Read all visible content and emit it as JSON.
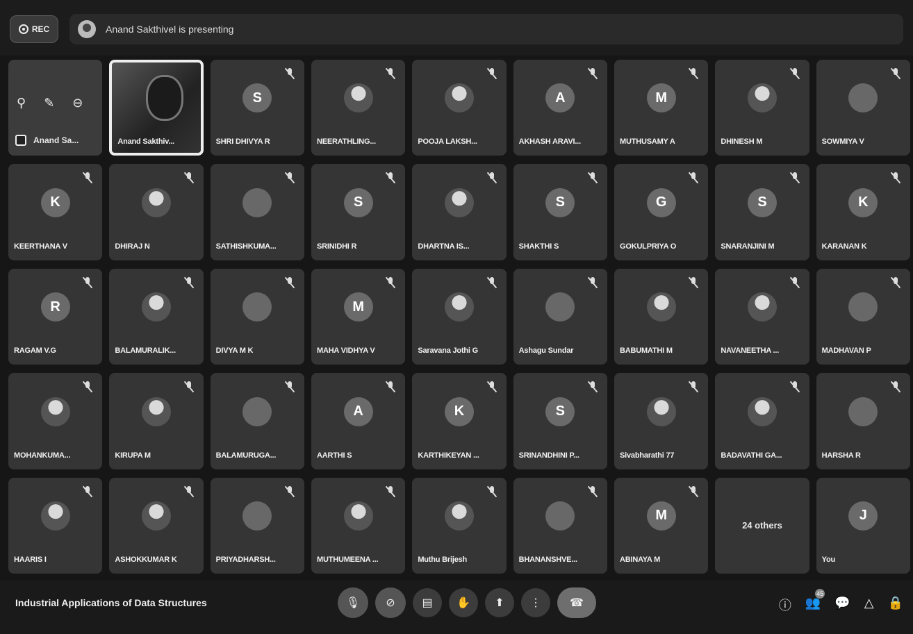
{
  "topbar": {
    "rec_label": "REC",
    "presenting_text": "Anand Sakthivel is presenting"
  },
  "self_tile": {
    "name": "Anand Sa..."
  },
  "presenter_tile": {
    "name": "Anand Sakthiv..."
  },
  "participants": [
    {
      "name": "SHRI DHIVYA R",
      "initial": "S"
    },
    {
      "name": "NEERATHLING...",
      "initial": ""
    },
    {
      "name": "POOJA LAKSH...",
      "initial": ""
    },
    {
      "name": "AKHASH ARAVI...",
      "initial": "A"
    },
    {
      "name": "MUTHUSAMY A",
      "initial": "M"
    },
    {
      "name": "DHINESH M",
      "initial": ""
    },
    {
      "name": "SOWMIYA V",
      "initial": ""
    },
    {
      "name": "KEERTHANA V",
      "initial": "K"
    },
    {
      "name": "DHIRAJ N",
      "initial": ""
    },
    {
      "name": "SATHISHKUMA...",
      "initial": ""
    },
    {
      "name": "SRINIDHI R",
      "initial": "S"
    },
    {
      "name": "DHARTNA IS...",
      "initial": ""
    },
    {
      "name": "SHAKTHI S",
      "initial": "S"
    },
    {
      "name": "GOKULPRIYA O",
      "initial": "G"
    },
    {
      "name": "SNARANJINI M",
      "initial": "S"
    },
    {
      "name": "KARANAN K",
      "initial": "K"
    },
    {
      "name": "RAGAM V.G",
      "initial": "R"
    },
    {
      "name": "BALAMURALIK...",
      "initial": ""
    },
    {
      "name": "DIVYA M K",
      "initial": ""
    },
    {
      "name": "MAHA VIDHYA V",
      "initial": "M"
    },
    {
      "name": "Saravana Jothi G",
      "initial": ""
    },
    {
      "name": "Ashagu Sundar",
      "initial": ""
    },
    {
      "name": "BABUMATHI M",
      "initial": ""
    },
    {
      "name": "NAVANEETHA ...",
      "initial": ""
    },
    {
      "name": "MADHAVAN P",
      "initial": ""
    },
    {
      "name": "MOHANKUMA...",
      "initial": ""
    },
    {
      "name": "KIRUPA M",
      "initial": ""
    },
    {
      "name": "BALAMURUGA...",
      "initial": ""
    },
    {
      "name": "AARTHI S",
      "initial": "A"
    },
    {
      "name": "KARTHIKEYAN ...",
      "initial": "K"
    },
    {
      "name": "SRINANDHINI P...",
      "initial": "S"
    },
    {
      "name": "Sivabharathi 77",
      "initial": ""
    },
    {
      "name": "BADAVATHI GA...",
      "initial": ""
    },
    {
      "name": "HARSHA R",
      "initial": ""
    },
    {
      "name": "HAARIS I",
      "initial": ""
    },
    {
      "name": "ASHOKKUMAR K",
      "initial": ""
    },
    {
      "name": "PRIYADHARSH...",
      "initial": ""
    },
    {
      "name": "MUTHUMEENA ...",
      "initial": ""
    },
    {
      "name": "Muthu Brijesh",
      "initial": ""
    },
    {
      "name": "BHANANSHVE...",
      "initial": ""
    },
    {
      "name": "ABINAYA M",
      "initial": "M"
    }
  ],
  "others_tile": {
    "label": "24 others"
  },
  "you_tile": {
    "name": "You",
    "initial": "J"
  },
  "bottombar": {
    "meeting_title": "Industrial Applications of Data Structures",
    "participants_badge": "45"
  },
  "icons": {
    "mic": "mic-icon",
    "camera": "camera-icon",
    "captions": "captions-icon",
    "raise_hand": "raise-hand-icon",
    "present": "present-icon",
    "more": "more-options-icon",
    "end_call": "end-call-icon",
    "info": "info-icon",
    "people": "people-icon",
    "chat": "chat-icon",
    "activities": "activities-icon",
    "host_controls": "host-controls-icon"
  }
}
